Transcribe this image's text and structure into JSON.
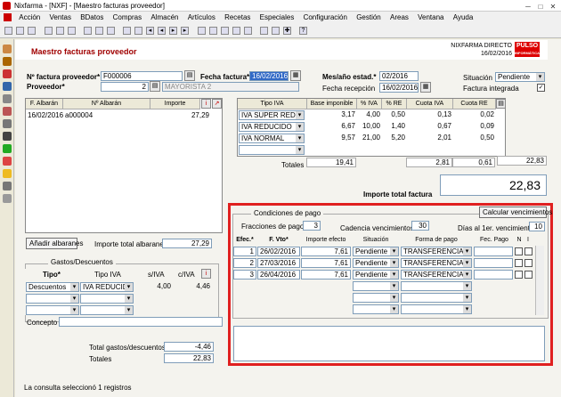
{
  "window": {
    "title": "Nixfarma - [NXF] - [Maestro facturas proveedor]"
  },
  "menu": [
    "Acción",
    "Ventas",
    "BDatos",
    "Compras",
    "Almacén",
    "Artículos",
    "Recetas",
    "Especiales",
    "Configuración",
    "Gestión",
    "Areas",
    "Ventana",
    "Ayuda"
  ],
  "header": {
    "title": "Maestro facturas proveedor",
    "brand": "NIXFARMA DIRECTO",
    "date": "16/02/2016",
    "logo_line1": "PULSO",
    "logo_line2": "INFORMÁTICA"
  },
  "form": {
    "factura_label": "Nº factura proveedor*",
    "factura_value": "F000006",
    "fecha_label": "Fecha factura*",
    "fecha_value": "16/02/2016",
    "proveedor_label": "Proveedor*",
    "proveedor_code": "2",
    "proveedor_name": "MAYORISTA 2",
    "mes_label": "Mes/año estad.*",
    "mes_value": "02/2016",
    "recepcion_label": "Fecha recepción",
    "recepcion_value": "16/02/2016",
    "situacion_label": "Situación",
    "situacion_value": "Pendiente",
    "integrada_label": "Factura integrada",
    "integrada_checked": "✓"
  },
  "albaranes": {
    "headers": [
      "F. Albarán",
      "Nº Albarán",
      "Importe"
    ],
    "rows": [
      {
        "fecha": "16/02/2016",
        "numero": "a000004",
        "importe": "27,29"
      }
    ],
    "add_button": "Añadir albaranes",
    "total_label": "Importe total albaranes",
    "total_value": "27,29"
  },
  "iva": {
    "headers": [
      "Tipo IVA",
      "Base imponible",
      "% IVA",
      "% RE",
      "Cuota IVA",
      "Cuota RE"
    ],
    "rows": [
      {
        "tipo": "IVA SUPER REDUCI",
        "base": "3,17",
        "piva": "4,00",
        "pre": "0,50",
        "cuota": "0,13",
        "cre": "0,02"
      },
      {
        "tipo": "IVA REDUCIDO",
        "base": "6,67",
        "piva": "10,00",
        "pre": "1,40",
        "cuota": "0,67",
        "cre": "0,09"
      },
      {
        "tipo": "IVA NORMAL",
        "base": "9,57",
        "piva": "21,00",
        "pre": "5,20",
        "cuota": "2,01",
        "cre": "0,50"
      }
    ],
    "totales_label": "Totales",
    "total_base": "19,41",
    "total_cuota": "2,81",
    "total_re": "0,61",
    "total_extra": "22,83",
    "importe_total_label": "Importe total factura",
    "importe_total_value": "22,83"
  },
  "gastos": {
    "section_label": "Gastos/Descuentos",
    "headers": [
      "Tipo*",
      "Tipo IVA",
      "s/IVA",
      "c/IVA"
    ],
    "rows": [
      {
        "tipo": "Descuentos",
        "tipo_iva": "IVA REDUCID",
        "siva": "4,00",
        "civa": "4,46"
      }
    ],
    "concepto_label": "Concepto",
    "concepto_value": "",
    "total_label": "Total gastos/descuentos",
    "total_value": "-4,46",
    "totales_label": "Totales",
    "totales_value": "22,83"
  },
  "pago": {
    "section_label": "Condiciones de pago",
    "calc_button": "Calcular vencimientos",
    "fracciones_label": "Fracciones de pago",
    "fracciones_value": "3",
    "cadencia_label": "Cadencia vencimientos",
    "cadencia_value": "30",
    "dias_label": "Días al 1er. vencimiento",
    "dias_value": "10",
    "headers": [
      "Efec.*",
      "F. Vto*",
      "Importe efecto",
      "Situación",
      "Forma de pago",
      "Fec. Pago",
      "N",
      "I"
    ],
    "rows": [
      {
        "n": "1",
        "fecha": "26/02/2016",
        "importe": "7,61",
        "situacion": "Pendiente",
        "forma": "TRANSFERENCIA"
      },
      {
        "n": "2",
        "fecha": "27/03/2016",
        "importe": "7,61",
        "situacion": "Pendiente",
        "forma": "TRANSFERENCIA"
      },
      {
        "n": "3",
        "fecha": "26/04/2016",
        "importe": "7,61",
        "situacion": "Pendiente",
        "forma": "TRANSFERENCIA"
      }
    ]
  },
  "status": {
    "text": "La consulta seleccionó 1  registros"
  },
  "colors": {
    "accent_red": "#e02020",
    "title_red": "#a00000",
    "selection_blue": "#3169c6"
  }
}
